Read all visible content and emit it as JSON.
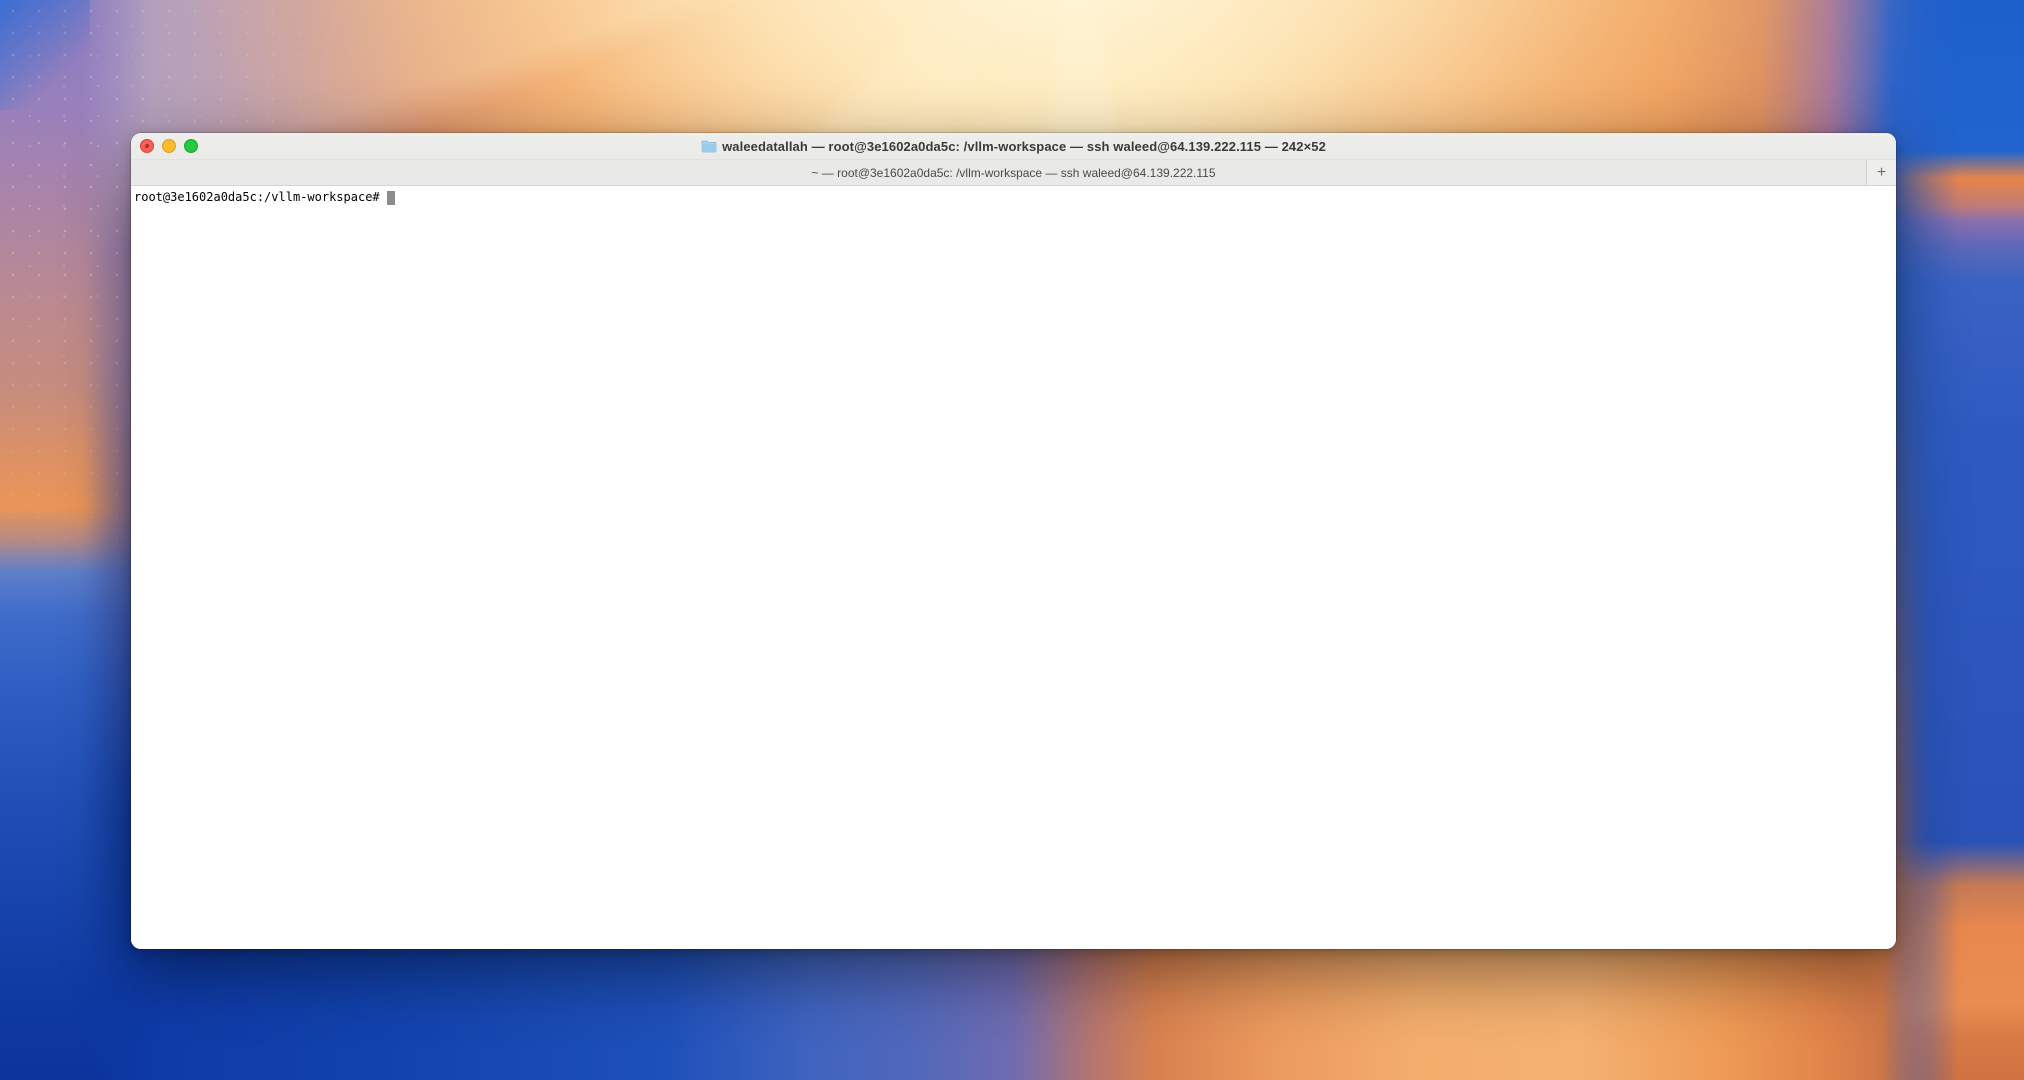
{
  "desktop": {
    "wallpaper_name": "macos-sequoia-abstract"
  },
  "window": {
    "title": "waleedatallah — root@3e1602a0da5c: /vllm-workspace — ssh waleed@64.139.222.115 — 242×52",
    "traffic_lights": {
      "close": "close",
      "minimize": "minimize",
      "zoom": "zoom"
    },
    "tab_bar": {
      "tab_title": "~ — root@3e1602a0da5c: /vllm-workspace — ssh waleed@64.139.222.115",
      "new_tab_label": "+"
    },
    "terminal": {
      "prompt": "root@3e1602a0da5c:/vllm-workspace#",
      "cursor_style": "block"
    }
  },
  "colors": {
    "traffic_red": "#ff5f57",
    "traffic_yellow": "#febc2e",
    "traffic_green": "#28c840",
    "titlebar_bg": "#ececea",
    "tabbar_bg": "#e9e9e7",
    "terminal_bg": "#ffffff",
    "terminal_text": "#000000",
    "cursor_gray": "#8c8c8c",
    "wallpaper_orange": "#ee9c5c",
    "wallpaper_cream": "#fdf0cc",
    "wallpaper_blue_deep": "#0b35a2",
    "wallpaper_blue": "#1e5cc9",
    "wallpaper_purple": "#8a7cc0"
  }
}
